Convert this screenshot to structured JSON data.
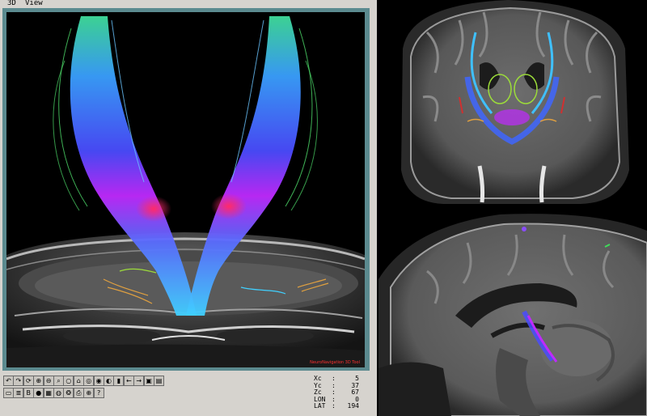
{
  "window": {
    "menu_3d": "3D",
    "menu_view": "View"
  },
  "viewport": {
    "watermark": "NeuroNavigation 3D Tool"
  },
  "toolbar": {
    "row1": [
      {
        "name": "rotate-left-icon",
        "glyph": "↶"
      },
      {
        "name": "rotate-right-icon",
        "glyph": "↷"
      },
      {
        "name": "refresh-icon",
        "glyph": "⟳"
      },
      {
        "name": "zoom-in-icon",
        "glyph": "⊕"
      },
      {
        "name": "zoom-out-icon",
        "glyph": "⊖"
      },
      {
        "name": "search-icon",
        "glyph": "⌕"
      },
      {
        "name": "circle-icon",
        "glyph": "○"
      },
      {
        "name": "home-icon",
        "glyph": "⌂"
      },
      {
        "name": "globe-icon",
        "glyph": "◎"
      },
      {
        "name": "target-icon",
        "glyph": "◉"
      },
      {
        "name": "contrast-icon",
        "glyph": "◐"
      },
      {
        "name": "box-icon",
        "glyph": "▮"
      },
      {
        "name": "arrow-left-icon",
        "glyph": "←"
      },
      {
        "name": "arrow-right-icon",
        "glyph": "→"
      },
      {
        "name": "camera-icon",
        "glyph": "▣"
      },
      {
        "name": "film-icon",
        "glyph": "▤"
      }
    ],
    "row2": [
      {
        "name": "window-icon",
        "glyph": "▭"
      },
      {
        "name": "layers-icon",
        "glyph": "≣"
      },
      {
        "name": "bev-icon",
        "glyph": "B"
      },
      {
        "name": "record-icon",
        "glyph": "●"
      },
      {
        "name": "grid-icon",
        "glyph": "▦"
      },
      {
        "name": "palette-icon",
        "glyph": "◍"
      },
      {
        "name": "brain-icon",
        "glyph": "❂"
      },
      {
        "name": "print-icon",
        "glyph": "⎙"
      },
      {
        "name": "crosshair-icon",
        "glyph": "⊕"
      },
      {
        "name": "help-icon",
        "glyph": "?"
      }
    ]
  },
  "coords": [
    {
      "label": "Xc",
      "value": "5"
    },
    {
      "label": "Yc",
      "value": "37"
    },
    {
      "label": "Zc",
      "value": "67"
    },
    {
      "label": "LON",
      "value": "0"
    },
    {
      "label": "LAT",
      "value": "194"
    }
  ],
  "colors": {
    "frame": "#d6d3ce",
    "viewport_border": "#5b8a8f",
    "tract_blue": "#3a4cff",
    "tract_magenta": "#d42aff",
    "tract_green": "#3fdc5a"
  }
}
